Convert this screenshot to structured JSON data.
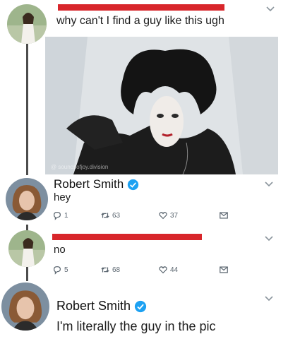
{
  "tweets": [
    {
      "text": "why can't I find a guy like this ugh",
      "image_watermark": "@ soundsofjoy.division"
    },
    {
      "author": "Robert Smith",
      "text": "hey",
      "replies": "1",
      "retweets": "63",
      "likes": "37"
    },
    {
      "text": "no",
      "replies": "5",
      "retweets": "68",
      "likes": "44"
    },
    {
      "author": "Robert Smith",
      "text": "I'm literally the guy in the pic"
    }
  ],
  "icons": {
    "reply": "reply-icon",
    "retweet": "retweet-icon",
    "like": "heart-icon",
    "message": "message-icon",
    "verified": "verified-badge-icon",
    "more": "chevron-down-icon"
  },
  "colors": {
    "redaction": "#d8262b",
    "verified": "#1da1f2",
    "thread_line": "#4d4d4d",
    "meta": "#5b6670"
  }
}
